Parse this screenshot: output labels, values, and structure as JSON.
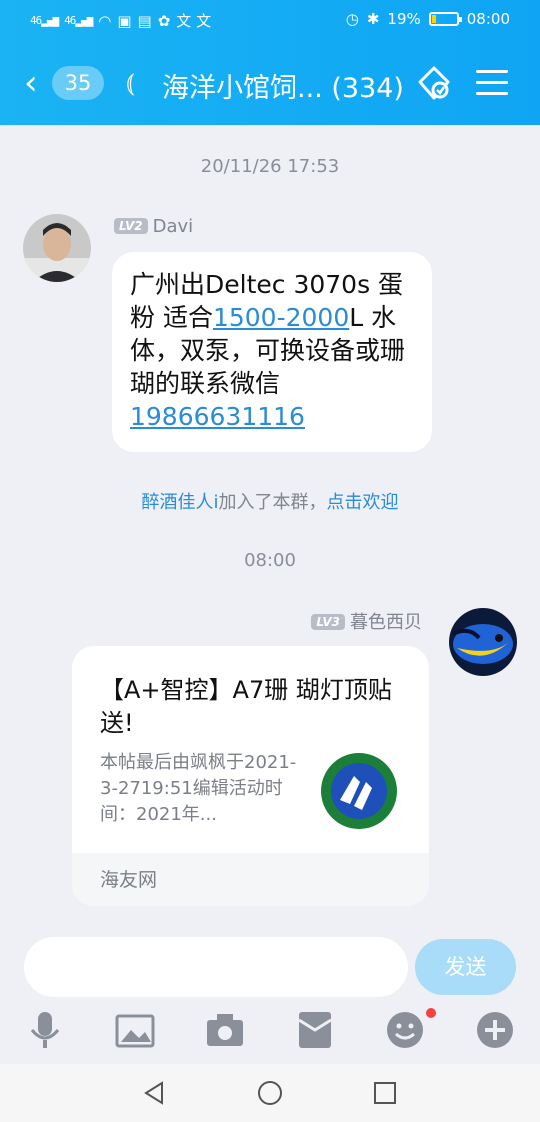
{
  "status": {
    "signal1": "46",
    "signal2": "46",
    "battery": "19%",
    "time": "08:00"
  },
  "header": {
    "back_count": "35",
    "title": "海洋小馆饲... (334)"
  },
  "messages": {
    "ts1": "20/11/26 17:53",
    "msg1": {
      "level": "LV2",
      "sender": "Davi",
      "text_a": "广州出Deltec 3070s 蛋粉 适合",
      "link_range": "1500-2000",
      "text_b": "L 水体，双泵，可换设备或珊瑚的联系微信",
      "link_phone": "19866631116"
    },
    "system": {
      "name": "醉酒佳人i",
      "text": "加入了本群，",
      "action": "点击欢迎"
    },
    "ts2": "08:00",
    "msg2": {
      "level": "LV3",
      "sender": "暮色西贝",
      "card_title": "【A+智控】A7珊 瑚灯顶贴送!",
      "card_desc": "本帖最后由飒枫于2021-3-2719:51编辑活动时间：2021年...",
      "card_source": "海友网"
    }
  },
  "input": {
    "send_label": "发送"
  },
  "colors": {
    "header": "#12aaf4",
    "link": "#2a8bd8",
    "send_button": "#a8dcf9",
    "background": "#eef0f6"
  },
  "icons": [
    "signal-icon",
    "wifi-icon",
    "alarm-icon",
    "bluetooth-icon",
    "ear-icon",
    "shield-icon",
    "menu-icon",
    "mic-icon",
    "image-icon",
    "camera-icon",
    "redpacket-icon",
    "emoji-icon",
    "plus-icon"
  ]
}
